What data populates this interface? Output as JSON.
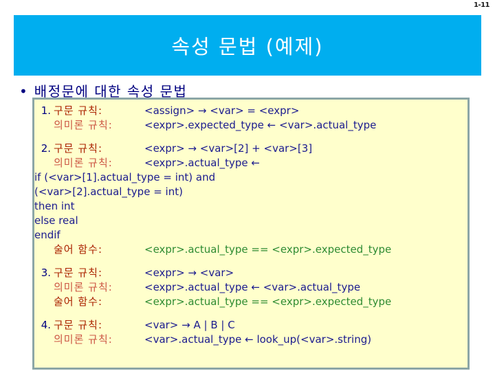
{
  "slide": {
    "number": "1-11",
    "title": "속성 문법 (예제)",
    "bullet_marker": "•",
    "bullet_text": "배정문에 대한 속성 문법"
  },
  "colors": {
    "title_band": "#00AEEF",
    "title_text": "#FFFFFF",
    "panel_bg": "#FFFFCC",
    "panel_border": "#8CA6A6",
    "heading_text": "#000080",
    "index_number": "#000080",
    "label_syntax": "#AA2200",
    "label_semantic": "#CC5544",
    "label_predicate": "#AA2200",
    "code_blue": "#1B1B8F",
    "code_green": "#2E8B32"
  },
  "labels": {
    "syntax_rule": "구문 규칙:",
    "semantic_rule": "의미론 규칙:",
    "predicate_function": "술어 함수:"
  },
  "rules": [
    {
      "index": "1.",
      "syntax_code": "<assign> → <var> = <expr>",
      "semantic_code": "<expr>.expected_type ← <var>.actual_type",
      "continuations": [],
      "predicate_code": null
    },
    {
      "index": "2.",
      "syntax_code": "<expr> → <var>[2] + <var>[3]",
      "semantic_code": "<expr>.actual_type ←",
      "continuations": [
        "if (<var>[1].actual_type = int) and",
        "(<var>[2].actual_type = int)",
        "then int",
        "else real",
        "endif"
      ],
      "predicate_code": "<expr>.actual_type == <expr>.expected_type"
    },
    {
      "index": "3.",
      "syntax_code": "<expr> → <var>",
      "semantic_code": "<expr>.actual_type ← <var>.actual_type",
      "continuations": [],
      "predicate_code": "<expr>.actual_type == <expr>.expected_type"
    },
    {
      "index": "4.",
      "syntax_code": "<var> → A | B | C",
      "semantic_code": "<var>.actual_type ← look_up(<var>.string)",
      "continuations": [],
      "predicate_code": null
    }
  ]
}
